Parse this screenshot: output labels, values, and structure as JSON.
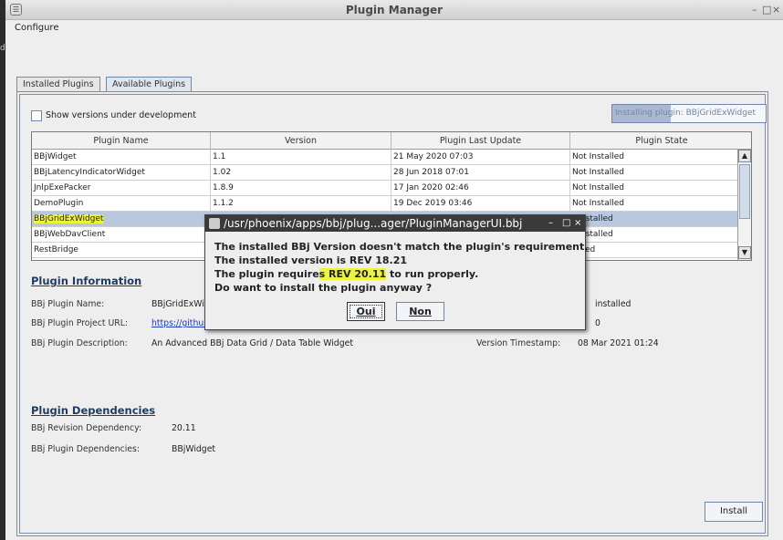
{
  "window": {
    "title": "Plugin Manager",
    "controls": [
      "–",
      "□",
      "×"
    ]
  },
  "menubar": {
    "items": [
      "Configure"
    ]
  },
  "tabs": [
    {
      "label": "Installed Plugins",
      "active": false
    },
    {
      "label": "Available Plugins",
      "active": true
    }
  ],
  "options": {
    "show_dev_label": "Show versions under development",
    "show_dev_checked": false
  },
  "progress": {
    "text": "Installing plugin: BBjGridExWidget",
    "fraction": 0.38
  },
  "table": {
    "columns": [
      "Plugin Name",
      "Version",
      "Plugin Last Update",
      "Plugin State"
    ],
    "rows": [
      {
        "name": "BBjWidget",
        "version": "1.1",
        "updated": "21 May 2020 07:03",
        "state": "Not Installed"
      },
      {
        "name": "BBjLatencyIndicatorWidget",
        "version": "1.02",
        "updated": "28 Jun 2018 07:01",
        "state": "Not Installed"
      },
      {
        "name": "JnlpExePacker",
        "version": "1.8.9",
        "updated": "17 Jan 2020 02:46",
        "state": "Not Installed"
      },
      {
        "name": "DemoPlugin",
        "version": "1.1.2",
        "updated": "19 Dec 2019 03:46",
        "state": "Not Installed"
      },
      {
        "name": "BBjGridExWidget",
        "version": "",
        "updated": "",
        "state": "nstalled",
        "selected": true
      },
      {
        "name": "BBjWebDavClient",
        "version": "",
        "updated": "",
        "state": "nstalled"
      },
      {
        "name": "RestBridge",
        "version": "",
        "updated": "",
        "state": "lled"
      }
    ]
  },
  "info": {
    "title": "Plugin Information",
    "name_label": "BBj Plugin Name:",
    "name_value": "BBjGridExWid",
    "url_label": "BBj Plugin Project URL:",
    "url_value": "https://github",
    "desc_label": "BBj Plugin Description:",
    "desc_value": "An Advanced BBj Data Grid / Data Table Widget",
    "right_state": "installed",
    "right_version": "0",
    "timestamp_label": "Version Timestamp:",
    "timestamp_value": "08 Mar 2021 01:24"
  },
  "deps": {
    "title": "Plugin Dependencies",
    "rev_label": "BBj Revision Dependency:",
    "rev_value": "20.11",
    "plugins_label": "BBj Plugin Dependencies:",
    "plugins_value": "BBjWidget"
  },
  "install_button": "Install",
  "dialog": {
    "title": "/usr/phoenix/apps/bbj/plug...ager/PluginManagerUI.bbj",
    "line1": "The installed BBj Version doesn't match the plugin's requirement.",
    "line2": "The installed version is REV 18.21",
    "line3_a": "The plugin require",
    "line3_hl": "s REV 20.11",
    "line3_b": " to run properly.",
    "line4": "Do want to install the plugin anyway ?",
    "yes_label": "Oui",
    "no_label": "Non"
  },
  "colors": {
    "highlight": "#ecf53b",
    "selection": "#b8c8de",
    "accent": "#6f87a8"
  }
}
